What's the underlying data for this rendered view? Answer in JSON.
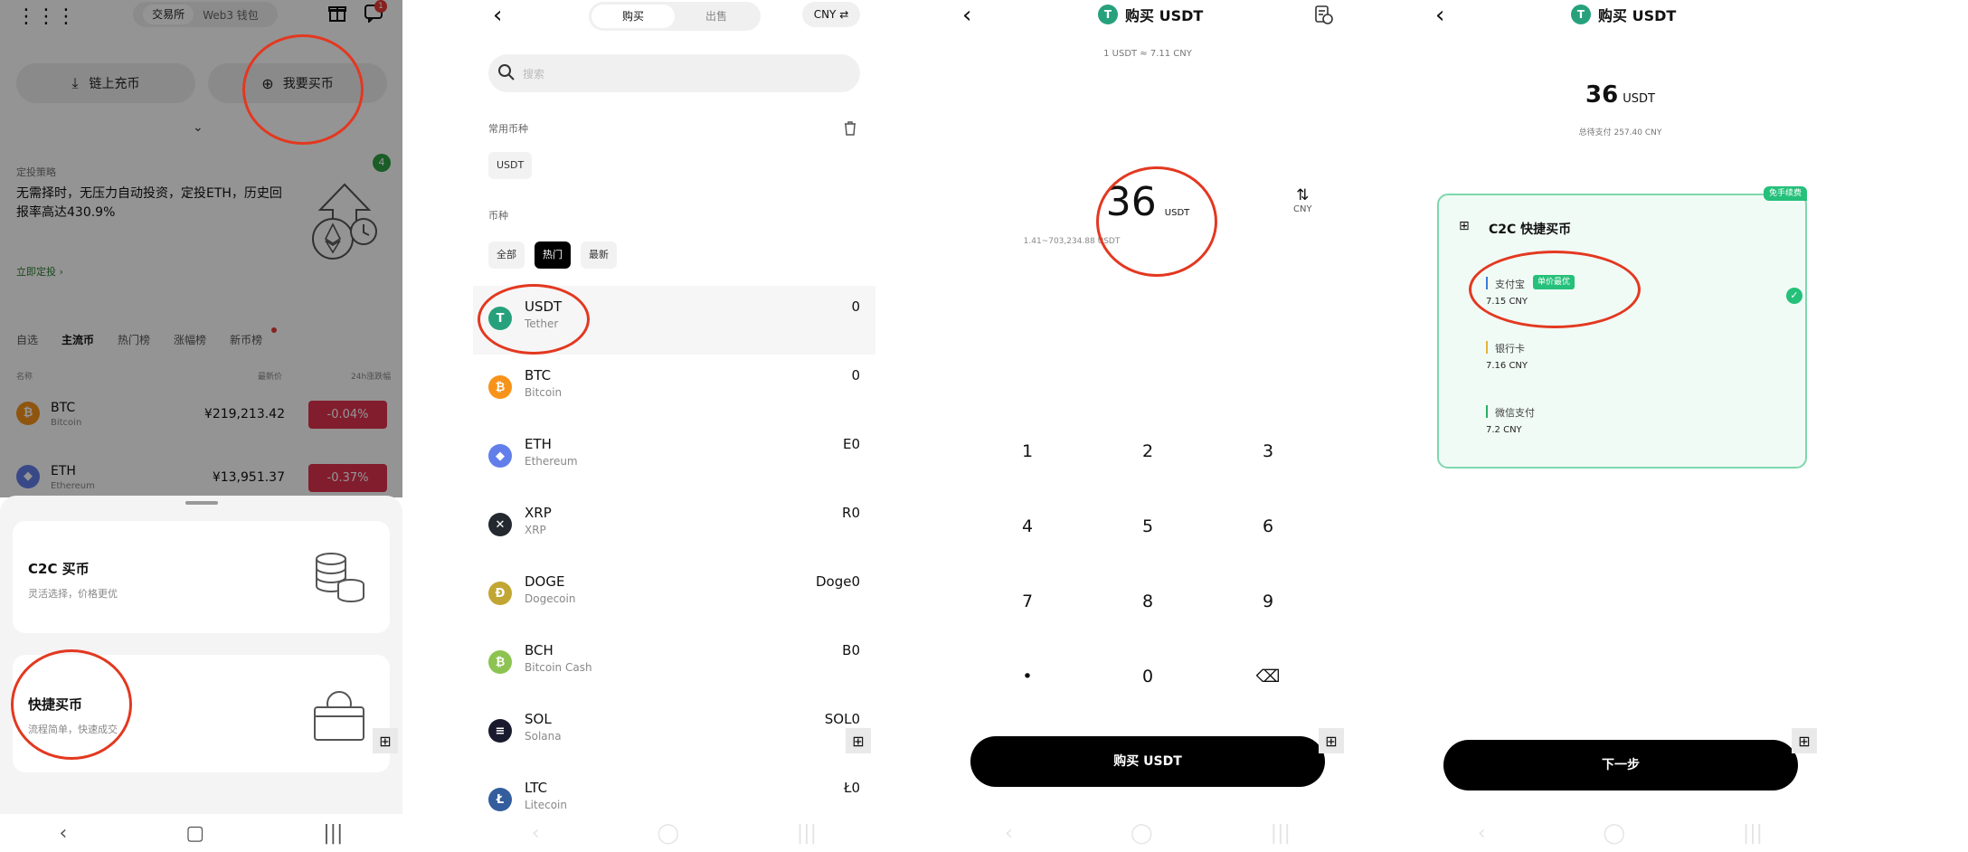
{
  "panel1": {
    "tabs": [
      "交易所",
      "Web3 钱包"
    ],
    "badge": "1",
    "deposit_label": "链上充币",
    "buy_label": "我要买币",
    "promo_tag": "定投策略",
    "promo_text": "无需择时，无压力自动投资，定投ETH，历史回报率高达430.9%",
    "promo_badge": "4",
    "promo_link": "立即定投",
    "market_tabs": [
      "自选",
      "主流币",
      "热门榜",
      "涨幅榜",
      "新币榜"
    ],
    "col_headers": [
      "名称",
      "最新价",
      "24h涨跌幅"
    ],
    "rows": [
      {
        "symbol": "BTC",
        "name": "Bitcoin",
        "price": "¥219,213.42",
        "change": "-0.04%"
      },
      {
        "symbol": "ETH",
        "name": "Ethereum",
        "price": "¥13,951.37",
        "change": "-0.37%"
      }
    ],
    "c2c_title": "C2C 买币",
    "c2c_sub": "灵活选择，价格更优",
    "quick_title": "快捷买币",
    "quick_sub": "流程简单，快速成交"
  },
  "panel2": {
    "seg": [
      "购买",
      "出售"
    ],
    "currency": "CNY",
    "search_placeholder": "搜索",
    "common_title": "常用币种",
    "common_chip": "USDT",
    "coins_title": "币种",
    "filters": [
      "全部",
      "热门",
      "最新"
    ],
    "coins": [
      {
        "symbol": "USDT",
        "name": "Tether",
        "balance": "0",
        "color": "#26a17b",
        "glyph": "T"
      },
      {
        "symbol": "BTC",
        "name": "Bitcoin",
        "balance": "0",
        "color": "#f7931a",
        "glyph": "₿"
      },
      {
        "symbol": "ETH",
        "name": "Ethereum",
        "balance": "E0",
        "color": "#627eea",
        "glyph": "◆"
      },
      {
        "symbol": "XRP",
        "name": "XRP",
        "balance": "R0",
        "color": "#23292f",
        "glyph": "✕"
      },
      {
        "symbol": "DOGE",
        "name": "Dogecoin",
        "balance": "Doge0",
        "color": "#c2a633",
        "glyph": "Ð"
      },
      {
        "symbol": "BCH",
        "name": "Bitcoin Cash",
        "balance": "B0",
        "color": "#8dc351",
        "glyph": "₿"
      },
      {
        "symbol": "SOL",
        "name": "Solana",
        "balance": "SOL0",
        "color": "#1a1a2e",
        "glyph": "≡"
      },
      {
        "symbol": "LTC",
        "name": "Litecoin",
        "balance": "Ł0",
        "color": "#345d9d",
        "glyph": "Ł"
      }
    ]
  },
  "panel3": {
    "title": "购买 USDT",
    "rate": "1 USDT ≈ 7.11 CNY",
    "amount": "36",
    "unit": "USDT",
    "range": "1.41~703,234.88 USDT",
    "toggle_label": "CNY",
    "keys": [
      "1",
      "2",
      "3",
      "4",
      "5",
      "6",
      "7",
      "8",
      "9",
      "•",
      "0",
      "⌫"
    ],
    "button": "购买 USDT"
  },
  "panel4": {
    "title": "购买 USDT",
    "amount": "36",
    "unit": "USDT",
    "total": "总待支付 257.40 CNY",
    "tag": "免手续费",
    "card_title": "C2C 快捷买币",
    "methods": [
      {
        "name": "支付宝",
        "price": "7.15 CNY",
        "badge": "单价最优",
        "bar": "#3a7bd5"
      },
      {
        "name": "银行卡",
        "price": "7.16 CNY",
        "badge": "",
        "bar": "#e6b23a"
      },
      {
        "name": "微信支付",
        "price": "7.2 CNY",
        "badge": "",
        "bar": "#2aae67"
      }
    ],
    "button": "下一步"
  }
}
